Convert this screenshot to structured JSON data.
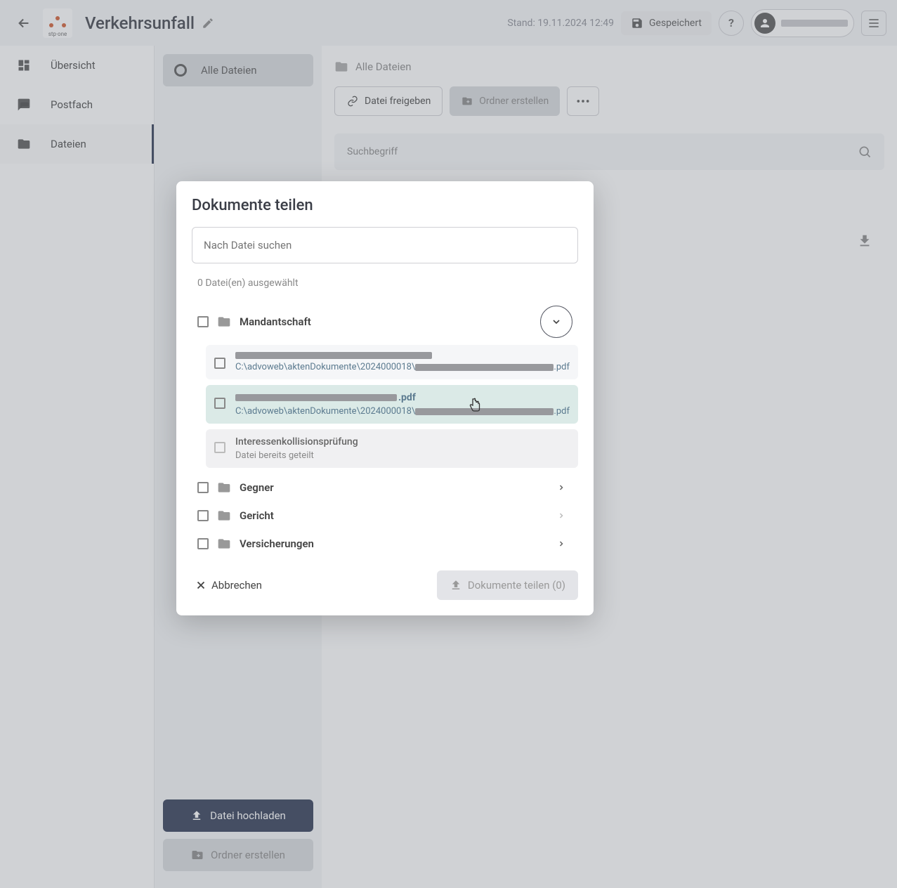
{
  "header": {
    "logo_text": "stp·one",
    "title": "Verkehrsunfall",
    "status": "Stand: 19.11.2024 12:49",
    "saved": "Gespeichert",
    "help": "?"
  },
  "sidebar": {
    "items": [
      {
        "label": "Übersicht"
      },
      {
        "label": "Postfach"
      },
      {
        "label": "Dateien"
      }
    ]
  },
  "col2": {
    "all_files": "Alle Dateien",
    "upload": "Datei hochladen",
    "create_folder": "Ordner erstellen"
  },
  "main": {
    "breadcrumb": "Alle Dateien",
    "share": "Datei freigeben",
    "create_folder": "Ordner erstellen",
    "search_placeholder": "Suchbegriff"
  },
  "modal": {
    "title": "Dokumente teilen",
    "search_placeholder": "Nach Datei suchen",
    "selected_count": "0 Datei(en) ausgewählt",
    "folders": [
      {
        "name": "Mandantschaft",
        "expanded": true
      },
      {
        "name": "Gegner",
        "expanded": false
      },
      {
        "name": "Gericht",
        "expanded": false
      },
      {
        "name": "Versicherungen",
        "expanded": false
      }
    ],
    "files": [
      {
        "path_prefix": "C:\\advoweb\\aktenDokumente\\2024000018\\",
        "path_suffix": ".pdf"
      },
      {
        "name_suffix": ".pdf",
        "path_prefix": "C:\\advoweb\\aktenDokumente\\2024000018\\",
        "path_suffix": ".pdf"
      },
      {
        "name": "Interessenkollisionsprüfung",
        "note": "Datei bereits geteilt"
      }
    ],
    "cancel": "Abbrechen",
    "share_btn": "Dokumente teilen (0)"
  }
}
